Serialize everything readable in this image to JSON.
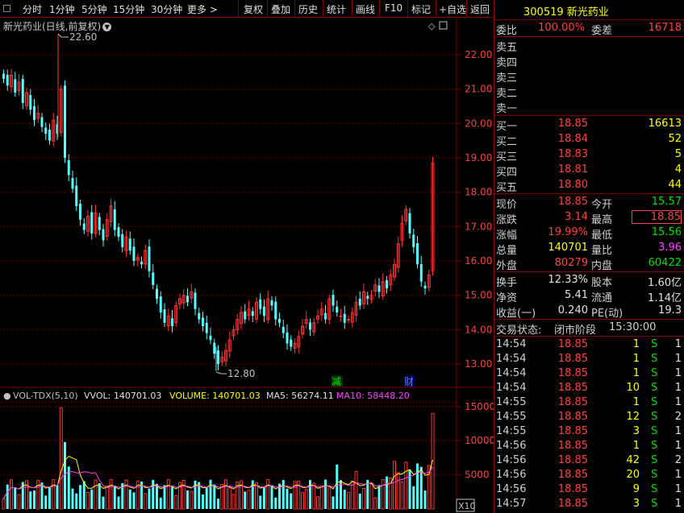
{
  "toolbar": {
    "periods": [
      "分时",
      "1分钟",
      "5分钟",
      "15分钟",
      "30分钟",
      "更多 >"
    ],
    "tools": [
      "复权",
      "叠加",
      "历史",
      "统计",
      "画线",
      "F10",
      "标记",
      "+自选",
      "返回"
    ]
  },
  "chart": {
    "title": "新光药业(日线,前复权)",
    "yticks": [
      "22.00",
      "21.00",
      "20.00",
      "19.00",
      "18.00",
      "17.00",
      "16.00",
      "15.00",
      "14.00",
      "13.00"
    ],
    "high_label": "22.60",
    "low_label": "12.80",
    "event_marker_1": "减",
    "event_marker_2": "财",
    "colors": {
      "up": "#ff3232",
      "down": "#54ffff",
      "grid": "#800000"
    }
  },
  "volume": {
    "indicator": "VOL-TDX(5,10)",
    "vvol": "VVOL: 140701.03",
    "volume": "VOLUME: 140701.03",
    "ma5": "MA5: 56274.11",
    "ma10": "MA10: 58448.20",
    "yticks": [
      "15000",
      "10000",
      "5000"
    ],
    "unit": "X10"
  },
  "quote": {
    "code_name": "300519 新光药业",
    "weibi_label": "委比",
    "weibi": "100.00%",
    "weicha_label": "委差",
    "weicha": "16718",
    "sell_labels": [
      "卖五",
      "卖四",
      "卖三",
      "卖二",
      "卖一"
    ],
    "buy": [
      {
        "label": "买一",
        "price": "18.85",
        "vol": "16613"
      },
      {
        "label": "买二",
        "price": "18.84",
        "vol": "52"
      },
      {
        "label": "买三",
        "price": "18.83",
        "vol": "5"
      },
      {
        "label": "买四",
        "price": "18.81",
        "vol": "4"
      },
      {
        "label": "买五",
        "price": "18.80",
        "vol": "44"
      }
    ],
    "stats": [
      {
        "l1": "现价",
        "v1": "18.85",
        "l2": "今开",
        "v2": "15.57"
      },
      {
        "l1": "涨跌",
        "v1": "3.14",
        "l2": "最高",
        "v2": "18.85"
      },
      {
        "l1": "涨幅",
        "v1": "19.99%",
        "l2": "最低",
        "v2": "15.56"
      },
      {
        "l1": "总量",
        "v1": "140701",
        "l2": "量比",
        "v2": "3.96"
      },
      {
        "l1": "外盘",
        "v1": "80279",
        "l2": "内盘",
        "v2": "60422"
      }
    ],
    "stats2": [
      {
        "l1": "换手",
        "v1": "12.33%",
        "l2": "股本",
        "v2": "1.60亿"
      },
      {
        "l1": "净资",
        "v1": "5.41",
        "l2": "流通",
        "v2": "1.14亿"
      },
      {
        "l1": "收益(一)",
        "v1": "0.240",
        "l2": "PE(动)",
        "v2": "19.3"
      }
    ],
    "trade_state_label": "交易状态:",
    "trade_state": "闭市阶段",
    "trade_time": "15:30:00"
  },
  "ticks": [
    {
      "time": "14:54",
      "price": "18.85",
      "vol": "1",
      "bs": "S",
      "n": "1"
    },
    {
      "time": "14:54",
      "price": "18.85",
      "vol": "1",
      "bs": "S",
      "n": "1"
    },
    {
      "time": "14:54",
      "price": "18.85",
      "vol": "1",
      "bs": "S",
      "n": "1"
    },
    {
      "time": "14:54",
      "price": "18.85",
      "vol": "10",
      "bs": "S",
      "n": "1"
    },
    {
      "time": "14:55",
      "price": "18.85",
      "vol": "1",
      "bs": "S",
      "n": "1"
    },
    {
      "time": "14:55",
      "price": "18.85",
      "vol": "12",
      "bs": "S",
      "n": "2"
    },
    {
      "time": "14:55",
      "price": "18.85",
      "vol": "3",
      "bs": "S",
      "n": "1"
    },
    {
      "time": "14:56",
      "price": "18.85",
      "vol": "1",
      "bs": "S",
      "n": "1"
    },
    {
      "time": "14:56",
      "price": "18.85",
      "vol": "42",
      "bs": "S",
      "n": "2"
    },
    {
      "time": "14:56",
      "price": "18.85",
      "vol": "20",
      "bs": "S",
      "n": "1"
    },
    {
      "time": "14:56",
      "price": "18.85",
      "vol": "9",
      "bs": "S",
      "n": "1"
    },
    {
      "time": "14:57",
      "price": "18.85",
      "vol": "3",
      "bs": "S",
      "n": "1"
    }
  ]
}
